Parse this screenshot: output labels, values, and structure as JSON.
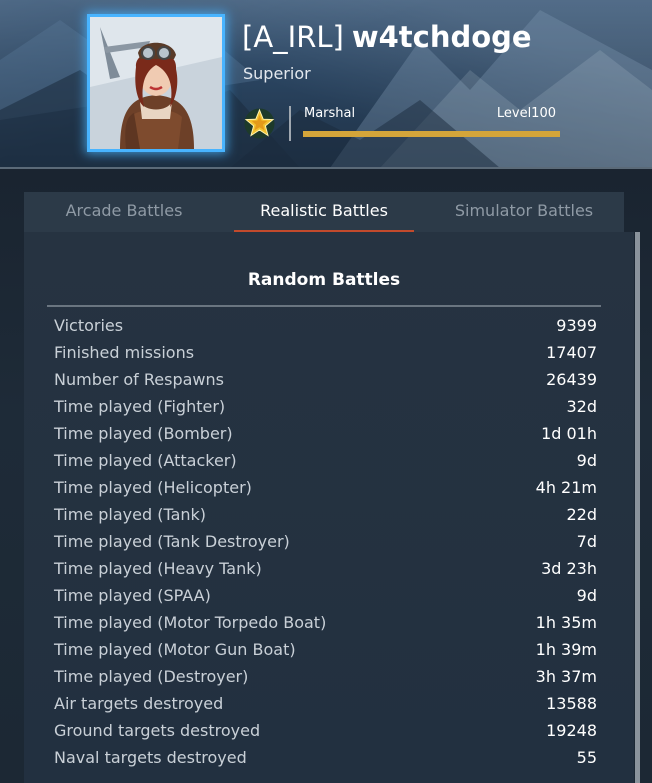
{
  "profile": {
    "clan_tag": "[A_IRL]",
    "nickname": "w4tchdoge",
    "title": "Superior",
    "rank_name": "Marshal",
    "level_label": "Level100",
    "level_progress": 1.0,
    "avatar_icon": "pilot-girl-avatar",
    "rank_icon": "star-rank-icon"
  },
  "tabs": [
    {
      "label": "Arcade Battles",
      "active": false
    },
    {
      "label": "Realistic Battles",
      "active": true
    },
    {
      "label": "Simulator Battles",
      "active": false
    }
  ],
  "section": {
    "title": "Random Battles"
  },
  "stats": [
    {
      "label": "Victories",
      "value": "9399"
    },
    {
      "label": "Finished missions",
      "value": "17407"
    },
    {
      "label": "Number of Respawns",
      "value": "26439"
    },
    {
      "label": "Time played (Fighter)",
      "value": "32d"
    },
    {
      "label": "Time played (Bomber)",
      "value": "1d 01h"
    },
    {
      "label": "Time played (Attacker)",
      "value": "9d"
    },
    {
      "label": "Time played (Helicopter)",
      "value": "4h 21m"
    },
    {
      "label": "Time played (Tank)",
      "value": "22d"
    },
    {
      "label": "Time played (Tank Destroyer)",
      "value": "7d"
    },
    {
      "label": "Time played (Heavy Tank)",
      "value": "3d 23h"
    },
    {
      "label": "Time played (SPAA)",
      "value": "9d"
    },
    {
      "label": "Time played (Motor Torpedo Boat)",
      "value": "1h 35m"
    },
    {
      "label": "Time played (Motor Gun Boat)",
      "value": "1h 39m"
    },
    {
      "label": "Time played (Destroyer)",
      "value": "3h 37m"
    },
    {
      "label": "Air targets destroyed",
      "value": "13588"
    },
    {
      "label": "Ground targets destroyed",
      "value": "19248"
    },
    {
      "label": "Naval targets destroyed",
      "value": "55"
    }
  ],
  "colors": {
    "avatar_border": "#48b4ff",
    "level_bar": "#d4a53a",
    "active_tab_underline": "#c24a2c"
  }
}
